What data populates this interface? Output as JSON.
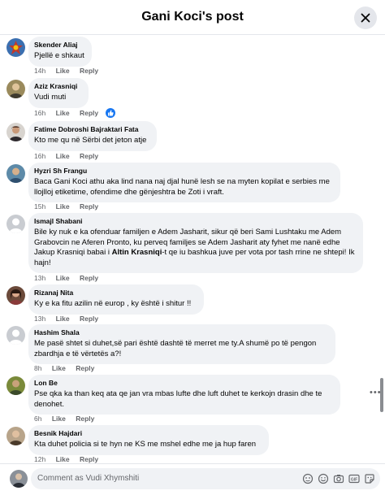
{
  "header": {
    "title": "Gani Koci's post"
  },
  "actions": {
    "like": "Like",
    "reply": "Reply"
  },
  "comments": [
    {
      "author": "Skender Aliaj",
      "text": "Pjellë e shkaut",
      "time": "14h"
    },
    {
      "author": "Aziz Krasniqi",
      "text": "Vudi muti",
      "time": "16h"
    },
    {
      "author": "Fatime Dobroshi Bajraktari Fata",
      "text": "Kto me qu në Sërbi det jeton atje",
      "time": "16h"
    },
    {
      "author": "Hyzri Sh Frangu",
      "text": "Baca Gani Koci athu aka lind nana naj djal hunë lesh se na myten kopilat e serbies me llojlloj etiketime, ofendime dhe gënjeshtra be Zoti i vraft.",
      "time": "15h"
    },
    {
      "author": "Ismajl Shabani",
      "text_before": "Bile ky nuk e ka ofenduar familjen e Adem Jasharit, sikur që beri Sami Lushtaku me Adem Grabovcin ne Aferen Pronto, ku perveq familjes se Adem Jasharit aty fyhet me nanë edhe Jakup Krasniqi babai i ",
      "mention": "Altin Krasniqi",
      "text_after": "-t qe iu bashkua juve per vota por tash rrine ne shtepi! Ik hajn!",
      "time": "13h"
    },
    {
      "author": "Rizanaj Nita",
      "text": "Ky e ka fitu azilin në europ , ky është i shitur !!",
      "time": "13h"
    },
    {
      "author": "Hashim Shala",
      "text": "Me pasë shtet si duhet,së pari është dashtë të merret me ty.A shumë po të pengon zbardhja e të vërtetës a?!",
      "time": "8h"
    },
    {
      "author": "Lon Be",
      "text": "Pse qka ka than keq ata qe jan vra mbas lufte dhe luft duhet te kerkojn drasin dhe te denohet.",
      "time": "6h"
    },
    {
      "author": "Besnik Hajdari",
      "text": "Kta duhet policia si te hyn ne KS me mshel edhe me ja hup faren",
      "time": "12h"
    }
  ],
  "composer": {
    "placeholder": "Comment as Vudi Xhymshiti"
  },
  "colors": {
    "bubble": "#f0f2f5",
    "meta": "#65676b",
    "accent": "#1877f2"
  }
}
